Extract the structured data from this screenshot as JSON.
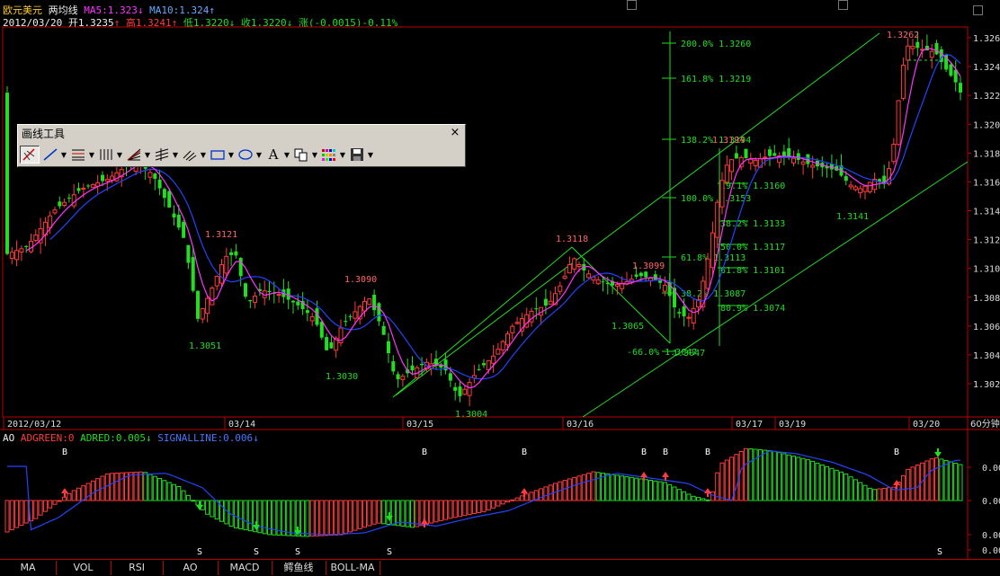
{
  "header": {
    "symbol": "欧元美元",
    "indicator": "两均线",
    "ma5_label": "MA5:1.323",
    "ma5_arrow": "↓",
    "ma10_label": "MA10:1.324",
    "ma10_arrow": "↑",
    "date": "2012/03/20",
    "open": "开1.3235",
    "open_arrow": "↑",
    "high": "高1.3241",
    "high_arrow": "↑",
    "low": "低1.3220",
    "low_arrow": "↓",
    "close": "收1.3220",
    "close_arrow": "↓",
    "change": "涨(-0.0015)-0.11%"
  },
  "price_axis": {
    "ticks": [
      "1.326",
      "1.324",
      "1.322",
      "1.320",
      "1.318",
      "1.316",
      "1.314",
      "1.312",
      "1.310",
      "1.308",
      "1.306",
      "1.304",
      "1.302"
    ]
  },
  "date_axis": {
    "labels": [
      "2012/03/12",
      "03/14",
      "03/15",
      "03/16",
      "03/17",
      "03/19",
      "03/20"
    ],
    "period": "60分钟"
  },
  "price_annotations": [
    "1.3121",
    "1.3051",
    "1.3090",
    "1.3030",
    "1.3004",
    "1.3118",
    "1.3065",
    "1.3099",
    "1.3047",
    "1.3262",
    "1.3194",
    "1.3141"
  ],
  "fib_levels": [
    "200.0% 1.3260",
    "161.8% 1.3219",
    "138.2% 1.3194",
    "100.0% 1.3153",
    "61.8% 1.3113",
    "38.2% 1.3087",
    "-66.0%  1.3047"
  ],
  "fib_retrace": [
    "19.1% 1.3160",
    "38.2% 1.3133",
    "50.0% 1.3117",
    "61.8% 1.3101",
    "80.9% 1.3074"
  ],
  "toolbox": {
    "title": "画线工具",
    "close_label": "×",
    "tools": [
      {
        "name": "pointer-icon"
      },
      {
        "name": "line-icon"
      },
      {
        "name": "channel-icon"
      },
      {
        "name": "vertical-lines-icon"
      },
      {
        "name": "fan-icon"
      },
      {
        "name": "parallel-lines-icon"
      },
      {
        "name": "gann-icon"
      },
      {
        "name": "rectangle-icon"
      },
      {
        "name": "ellipse-icon"
      },
      {
        "name": "text-icon"
      },
      {
        "name": "copy-icon"
      },
      {
        "name": "color-icon"
      },
      {
        "name": "save-icon"
      }
    ],
    "text_tool_glyph": "A"
  },
  "ao_header": {
    "name": "AO",
    "adgreen": "ADGREEN:0",
    "adred": "ADRED:0.005",
    "adred_arrow": "↓",
    "signal": "SIGNALLINE:0.006",
    "signal_arrow": "↓"
  },
  "ao_axis": {
    "ticks": [
      "0.00",
      "0.00",
      "0.00",
      "0.00"
    ]
  },
  "ao_markers": {
    "buy": "B",
    "sell": "S"
  },
  "tabs": [
    "MA",
    "VOL",
    "RSI",
    "AO",
    "MACD",
    "鳄鱼线",
    "BOLL-MA"
  ],
  "colors": {
    "up": "#ff3b3b",
    "down": "#22dd22",
    "ma5": "#ff33ff",
    "ma10": "#3355ff",
    "frame": "#b00000",
    "fib": "#22dd22"
  }
}
